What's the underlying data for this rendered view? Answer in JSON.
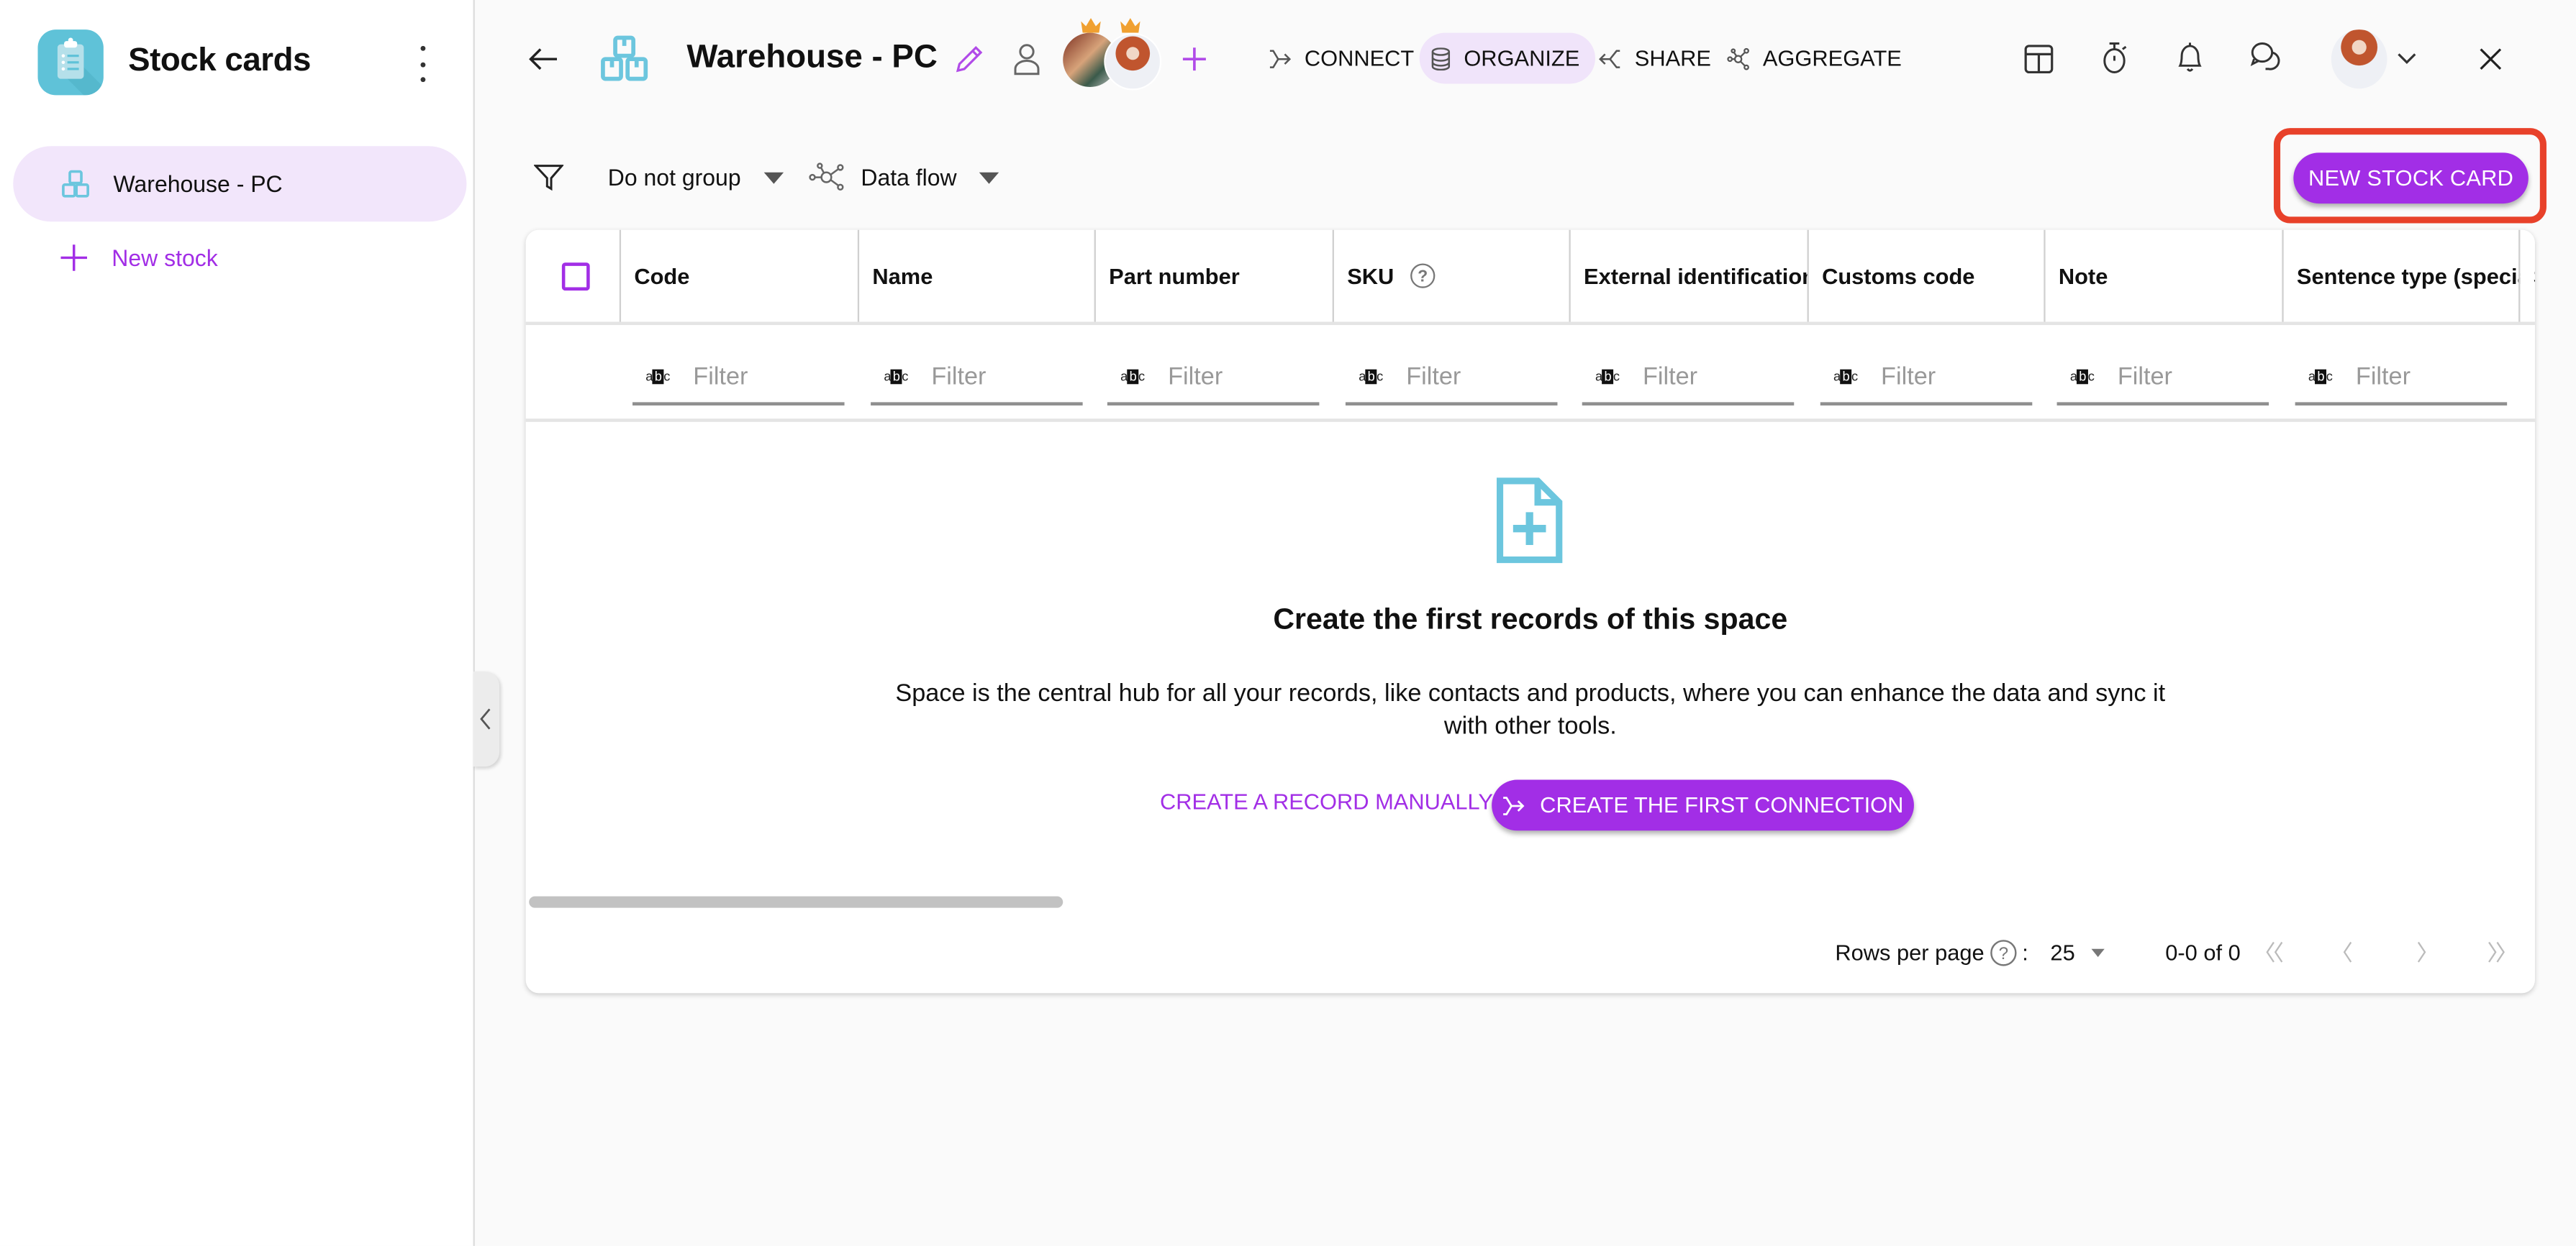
{
  "sidebar": {
    "app_title": "Stock cards",
    "items": [
      {
        "label": "Warehouse - PC",
        "icon": "boxes-icon",
        "active": true
      }
    ],
    "new_label": "New stock"
  },
  "header": {
    "space_title": "Warehouse - PC",
    "tabs": [
      {
        "label": "CONNECT",
        "icon": "connect-icon",
        "active": false
      },
      {
        "label": "ORGANIZE",
        "icon": "database-icon",
        "active": true
      },
      {
        "label": "SHARE",
        "icon": "share-icon",
        "active": false
      },
      {
        "label": "AGGREGATE",
        "icon": "aggregate-icon",
        "active": false
      }
    ]
  },
  "toolbar": {
    "group_label": "Do not group",
    "dataflow_label": "Data flow",
    "new_button": "NEW STOCK CARD"
  },
  "table": {
    "columns": [
      "Code",
      "Name",
      "Part number",
      "SKU",
      "External identification",
      "Customs code",
      "Note",
      "Sentence type (special",
      "S"
    ],
    "filter_placeholder": "Filter",
    "filter_type_label": "abc"
  },
  "empty_state": {
    "title": "Create the first records of this space",
    "description": "Space is the central hub for all your records, like contacts and products, where you can enhance the data and sync it with other tools.",
    "manual_label": "CREATE A RECORD MANUALLY",
    "connection_label": "CREATE THE FIRST CONNECTION"
  },
  "pagination": {
    "rows_per_page_label": "Rows per page",
    "rows_per_page_value": "25",
    "range": "0-0 of 0"
  },
  "colors": {
    "accent": "#a22ee6",
    "teal": "#5fc2d8",
    "highlight": "#e8412a",
    "active_bg": "#f2e6fb"
  }
}
